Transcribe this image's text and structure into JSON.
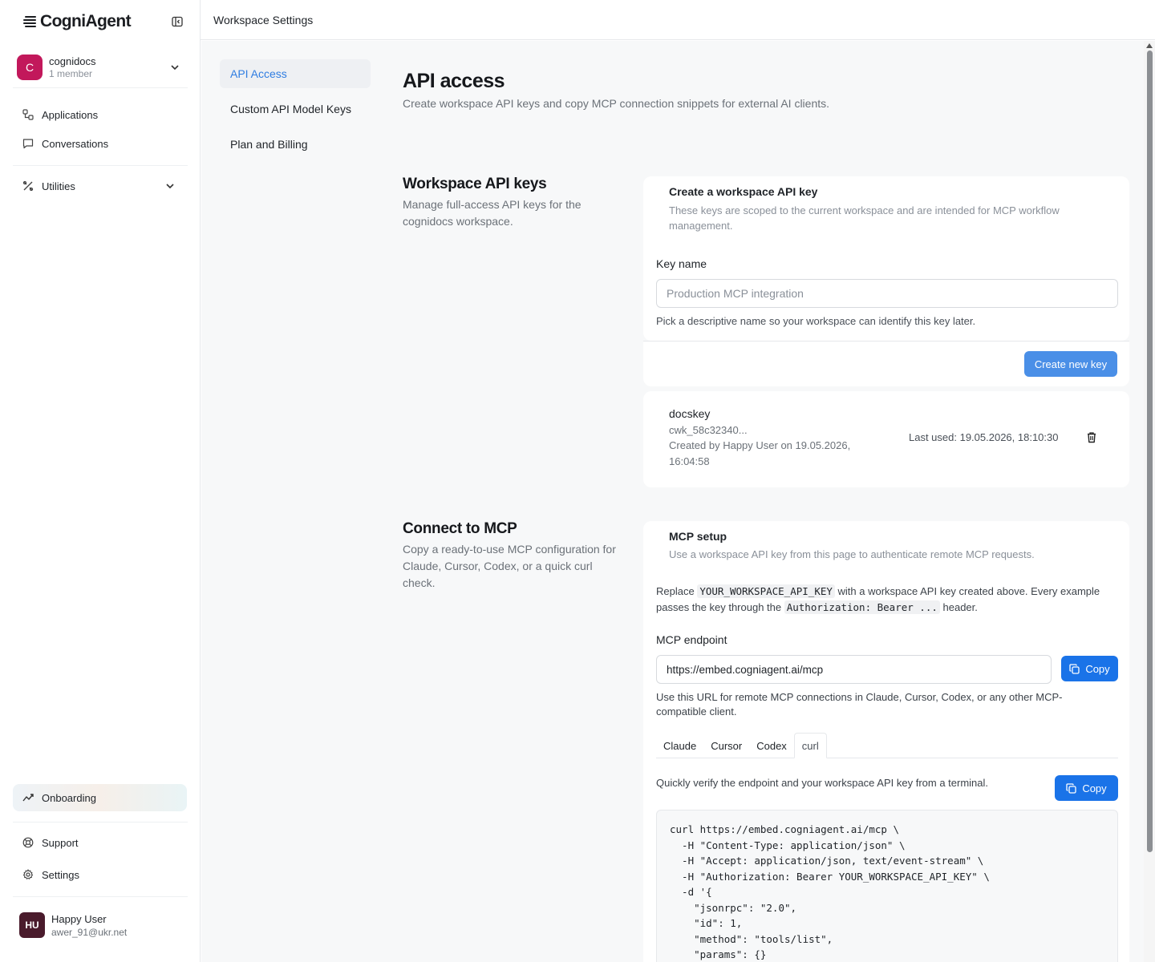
{
  "app": {
    "logo_text": "CogniAgent",
    "header_title": "Workspace Settings"
  },
  "workspace": {
    "initial": "C",
    "name": "cognidocs",
    "members": "1 member",
    "avatar_color": "#c2185b"
  },
  "sidebar": {
    "nav": [
      {
        "label": "Applications",
        "icon": "applications-icon"
      },
      {
        "label": "Conversations",
        "icon": "chat-icon"
      }
    ],
    "utilities_label": "Utilities",
    "onboarding_label": "Onboarding",
    "bottom": [
      {
        "label": "Support",
        "icon": "lifebuoy-icon"
      },
      {
        "label": "Settings",
        "icon": "gear-icon"
      }
    ]
  },
  "user": {
    "initials": "HU",
    "name": "Happy User",
    "email": "awer_91@ukr.net"
  },
  "subnav": {
    "items": [
      "API Access",
      "Custom API Model Keys",
      "Plan and Billing"
    ],
    "active": "API Access"
  },
  "page": {
    "title": "API access",
    "subtitle": "Create workspace API keys and copy MCP connection snippets for external AI clients."
  },
  "keys_section": {
    "title": "Workspace API keys",
    "desc": "Manage full-access API keys for the cognidocs workspace.",
    "card_title": "Create a workspace API key",
    "card_desc": "These keys are scoped to the current workspace and are intended for MCP workflow management.",
    "key_name_label": "Key name",
    "key_name_placeholder": "Production MCP integration",
    "key_name_hint": "Pick a descriptive name so your workspace can identify this key later.",
    "create_button": "Create new key",
    "keys": [
      {
        "name": "docskey",
        "prefix": "cwk_58c32340...",
        "created_line1": "Created by Happy User on 19.05.2026,",
        "created_line2": "16:04:58",
        "last_used": "Last used: 19.05.2026, 18:10:30"
      }
    ]
  },
  "mcp_section": {
    "title": "Connect to MCP",
    "desc": "Copy a ready-to-use MCP configuration for Claude, Cursor, Codex, or a quick curl check.",
    "card_title": "MCP setup",
    "card_desc": "Use a workspace API key from this page to authenticate remote MCP requests.",
    "replace_text_1": "Replace",
    "replace_code_1": "YOUR_WORKSPACE_API_KEY",
    "replace_text_2": "with a workspace API key created above. Every example passes the key through the",
    "replace_code_2": "Authorization: Bearer ...",
    "replace_text_3": "header.",
    "endpoint_label": "MCP endpoint",
    "endpoint_value": "https://embed.cogniagent.ai/mcp",
    "copy_label": "Copy",
    "endpoint_hint": "Use this URL for remote MCP connections in Claude, Cursor, Codex, or any other MCP-compatible client.",
    "tabs": [
      "Claude",
      "Cursor",
      "Codex",
      "curl"
    ],
    "active_tab": "curl",
    "curl_hint": "Quickly verify the endpoint and your workspace API key from a terminal.",
    "code_lines": [
      "curl https://embed.cogniagent.ai/mcp \\",
      "  -H \"Content-Type: application/json\" \\",
      "  -H \"Accept: application/json, text/event-stream\" \\",
      "  -H \"Authorization: Bearer YOUR_WORKSPACE_API_KEY\" \\",
      "  -d '{",
      "    \"jsonrpc\": \"2.0\",",
      "    \"id\": 1,",
      "    \"method\": \"tools/list\",",
      "    \"params\": {}"
    ]
  },
  "colors": {
    "accent": "#1a73e8",
    "active_nav_text": "#2f7de1"
  }
}
